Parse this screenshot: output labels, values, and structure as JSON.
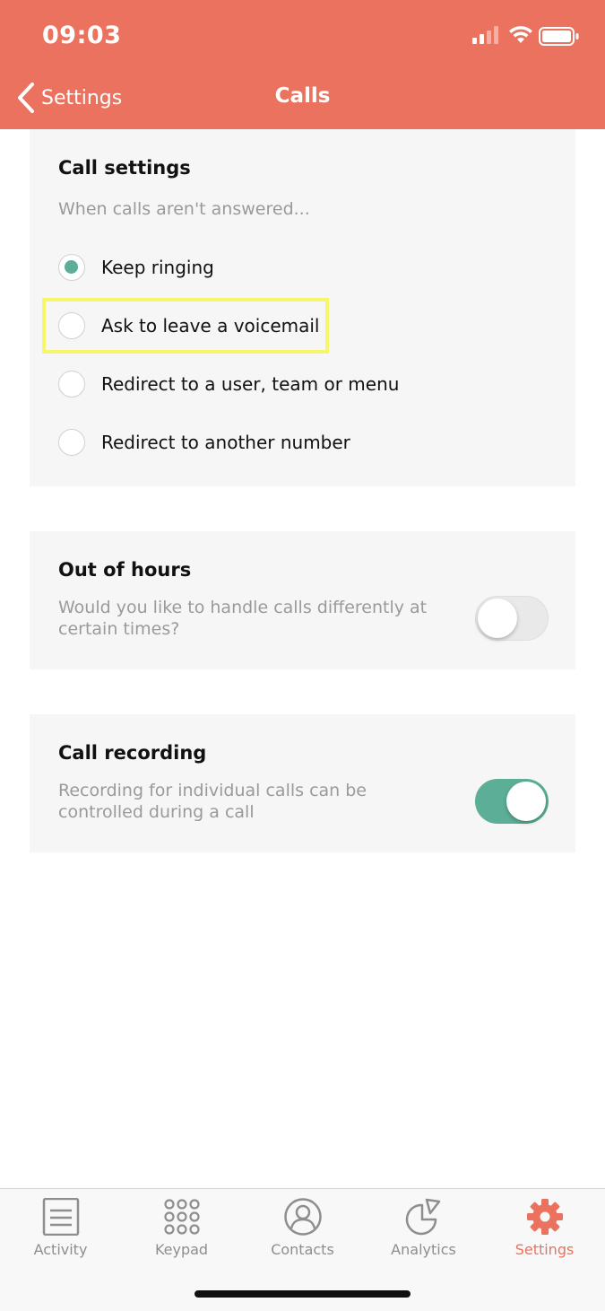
{
  "status_bar": {
    "time": "09:03"
  },
  "nav": {
    "back_label": "Settings",
    "title": "Calls"
  },
  "call_settings": {
    "title": "Call settings",
    "subtitle": "When calls aren't answered...",
    "options": [
      {
        "label": "Keep ringing",
        "selected": true
      },
      {
        "label": "Ask to leave a voicemail",
        "selected": false
      },
      {
        "label": "Redirect to a user, team or menu",
        "selected": false
      },
      {
        "label": "Redirect to another number",
        "selected": false
      }
    ]
  },
  "out_of_hours": {
    "title": "Out of hours",
    "description_line1": "Would you like to handle calls differently at",
    "description_line2": "certain times?",
    "enabled": false
  },
  "call_recording": {
    "title": "Call recording",
    "description_line1": "Recording for individual calls can be",
    "description_line2": "controlled during a call",
    "enabled": true
  },
  "tabbar": {
    "tabs": [
      {
        "label": "Activity",
        "icon": "activity-icon",
        "active": false
      },
      {
        "label": "Keypad",
        "icon": "keypad-icon",
        "active": false
      },
      {
        "label": "Contacts",
        "icon": "contacts-icon",
        "active": false
      },
      {
        "label": "Analytics",
        "icon": "analytics-icon",
        "active": false
      },
      {
        "label": "Settings",
        "icon": "gear-icon",
        "active": true
      }
    ]
  },
  "colors": {
    "brand": "#ea725e",
    "accent": "#5cae96",
    "highlight": "#f7f56a"
  }
}
